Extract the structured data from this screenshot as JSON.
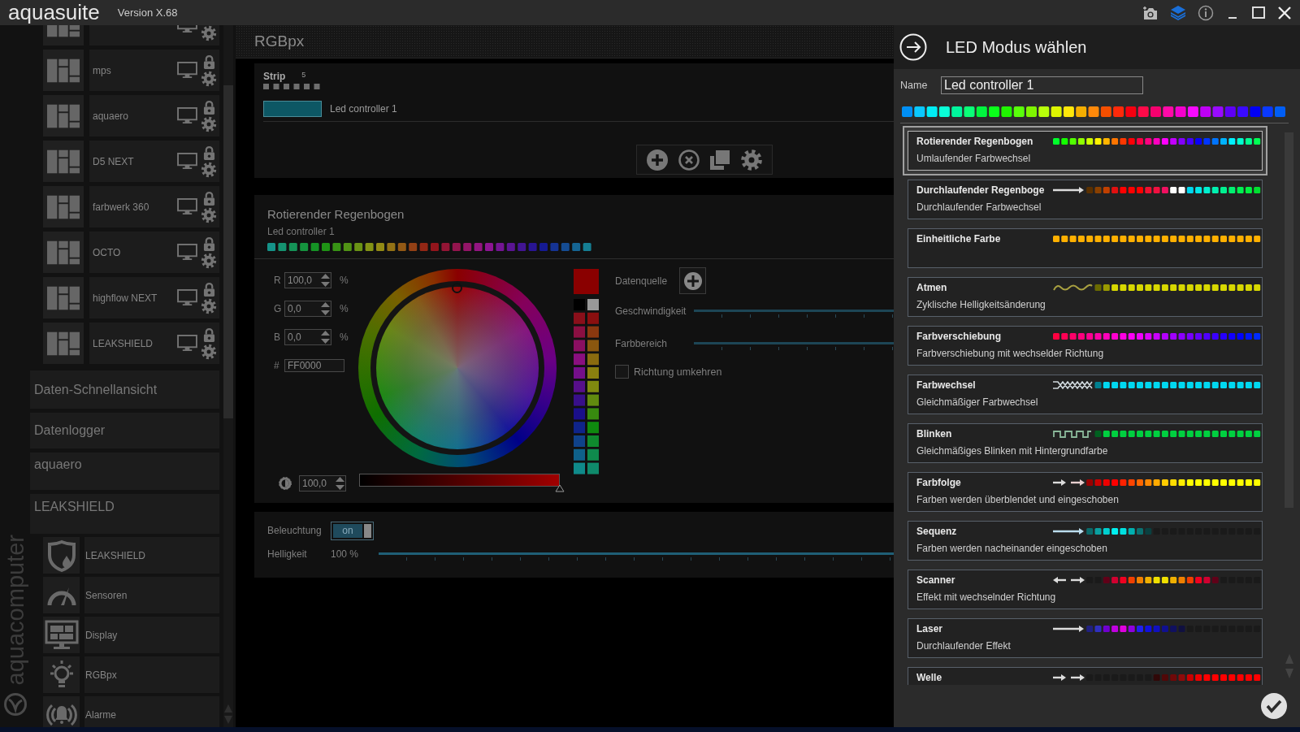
{
  "window": {
    "app_name": "aquasuite",
    "version": "Version X.68"
  },
  "sidebar": {
    "devices": [
      {
        "name": "mps"
      },
      {
        "name": "aquaero"
      },
      {
        "name": "D5 NEXT"
      },
      {
        "name": "farbwerk 360"
      },
      {
        "name": "OCTO"
      },
      {
        "name": "highflow NEXT"
      },
      {
        "name": "LEAKSHIELD"
      }
    ],
    "sections": [
      {
        "label": "Daten-Schnellansicht"
      },
      {
        "label": "Datenlogger"
      },
      {
        "label": "aquaero"
      },
      {
        "label": "LEAKSHIELD"
      }
    ],
    "pages": [
      {
        "label": "LEAKSHIELD",
        "kind": "shield"
      },
      {
        "label": "Sensoren",
        "kind": "gauge"
      },
      {
        "label": "Display",
        "kind": "display"
      },
      {
        "label": "RGBpx",
        "kind": "bulb"
      },
      {
        "label": "Alarme",
        "kind": "alarm"
      }
    ],
    "brand": "aquacomputer"
  },
  "main": {
    "title": "RGBpx",
    "strip": {
      "label": "Strip",
      "count": "5",
      "controller": "Led controller 1"
    },
    "effect": {
      "title": "Rotierender Regenbogen",
      "controller": "Led controller 1",
      "channels": [
        {
          "label": "R",
          "value": "100,0",
          "unit": "%"
        },
        {
          "label": "G",
          "value": "0,0",
          "unit": "%"
        },
        {
          "label": "B",
          "value": "0,0",
          "unit": "%"
        }
      ],
      "hex_label": "#",
      "hex": "FF0000",
      "brightness": "100,0",
      "data_source": "Datenquelle",
      "speed": "Geschwindigkeit",
      "range": "Farbbereich",
      "reverse": {
        "label": "Richtung umkehren",
        "checked": false
      }
    },
    "lighting": {
      "label": "Beleuchtung",
      "state": "on",
      "on": true,
      "brightness_label": "Helligkeit",
      "brightness": "100 %",
      "level": 1
    }
  },
  "mode_panel": {
    "title": "LED Modus wählen",
    "name_label": "Name",
    "name": "Led controller 1",
    "modes": [
      {
        "title": "Rotierender Regenbogen",
        "description": "Umlaufender Farbwechsel",
        "kind": "rainbow",
        "selected": true
      },
      {
        "title": "Durchlaufender Regenboge",
        "description": "Durchlaufender Farbwechsel",
        "kind": "running",
        "selected": false
      },
      {
        "title": "Einheitliche Farbe",
        "kind": "solid",
        "selected": false
      },
      {
        "title": "Atmen",
        "description": "Zyklische Helligkeitsänderung",
        "kind": "breathe",
        "selected": false
      },
      {
        "title": "Farbverschiebung",
        "description": "Farbverschiebung mit wechselder Richtung",
        "kind": "shift",
        "selected": false
      },
      {
        "title": "Farbwechsel",
        "description": "Gleichmäßiger Farbwechsel",
        "kind": "fade",
        "selected": false
      },
      {
        "title": "Blinken",
        "description": "Gleichmäßiges Blinken mit Hintergrundfarbe",
        "kind": "blink",
        "selected": false
      },
      {
        "title": "Farbfolge",
        "description": "Farben werden überblendet und eingeschoben",
        "kind": "flow",
        "selected": false
      },
      {
        "title": "Sequenz",
        "description": "Farben werden nacheinander eingeschoben",
        "kind": "sequence",
        "selected": false
      },
      {
        "title": "Scanner",
        "description": "Effekt mit wechselnder Richtung",
        "kind": "scanner",
        "selected": false
      },
      {
        "title": "Laser",
        "description": "Durchlaufender Effekt",
        "kind": "laser",
        "selected": false
      },
      {
        "title": "Welle",
        "kind": "wave",
        "selected": false
      }
    ]
  }
}
